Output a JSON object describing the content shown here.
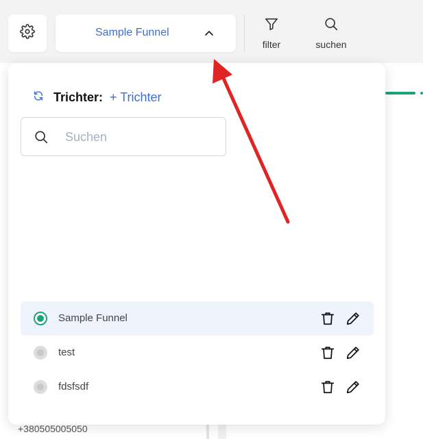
{
  "topbar": {
    "funnel_select_label": "Sample Funnel",
    "filter_label": "filter",
    "search_label": "suchen",
    "icons": {
      "settings": "gear-icon",
      "chevron": "chevron-up-icon",
      "filter": "filter-icon",
      "search": "search-icon"
    }
  },
  "background": {
    "phone_number": "+380505005050"
  },
  "funnel_panel": {
    "refresh_icon": "refresh-icon",
    "title": "Trichter:",
    "add_label": "+ Trichter",
    "search": {
      "placeholder": "Suchen",
      "value": ""
    },
    "funnels": [
      {
        "name": "Sample Funnel",
        "selected": true
      },
      {
        "name": "test",
        "selected": false
      },
      {
        "name": "fdsfsdf",
        "selected": false
      }
    ]
  },
  "annotation": {
    "arrow_color": "#e02424"
  },
  "colors": {
    "accent_blue": "#3b6fd6",
    "accent_green": "#1aa37a"
  }
}
